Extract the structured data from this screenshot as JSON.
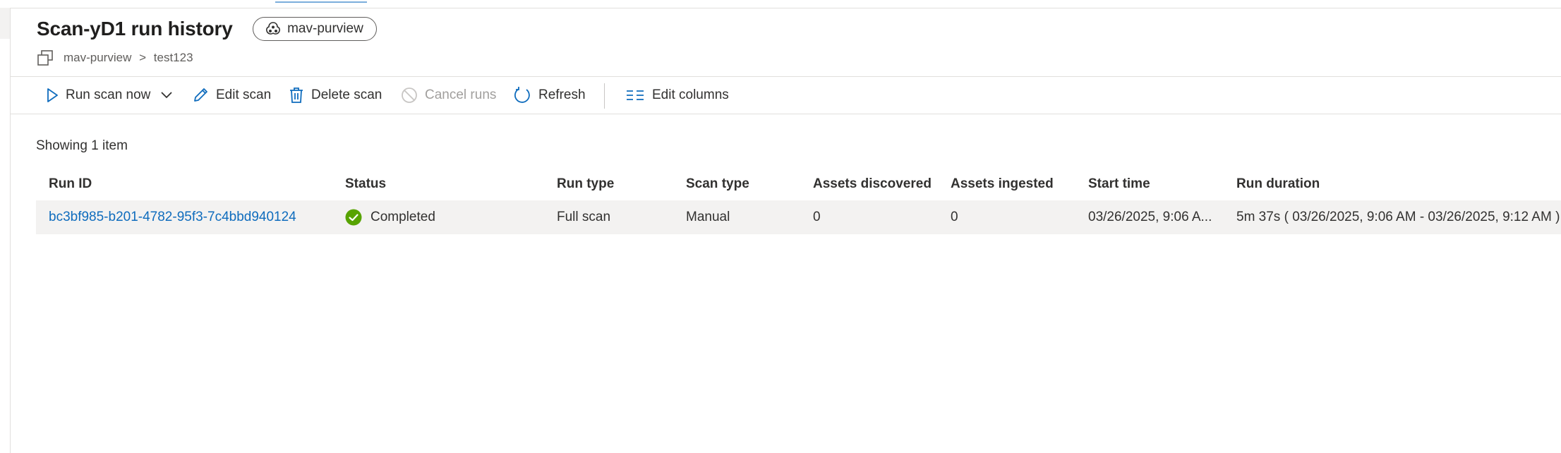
{
  "page": {
    "title": "Scan-yD1 run history",
    "data_source_pill": "mav-purview"
  },
  "breadcrumb": {
    "parent": "mav-purview",
    "separator": ">",
    "current": "test123"
  },
  "toolbar": {
    "run_scan_now": "Run scan now",
    "edit_scan": "Edit scan",
    "delete_scan": "Delete scan",
    "cancel_runs": "Cancel runs",
    "refresh": "Refresh",
    "edit_columns": "Edit columns"
  },
  "list": {
    "showing_text": "Showing 1 item",
    "columns": {
      "run_id": "Run ID",
      "status": "Status",
      "run_type": "Run type",
      "scan_type": "Scan type",
      "assets_discovered": "Assets discovered",
      "assets_ingested": "Assets ingested",
      "start_time": "Start time",
      "run_duration": "Run duration"
    },
    "rows": [
      {
        "run_id": "bc3bf985-b201-4782-95f3-7c4bbd940124",
        "status": "Completed",
        "run_type": "Full scan",
        "scan_type": "Manual",
        "assets_discovered": "0",
        "assets_ingested": "0",
        "start_time": "03/26/2025, 9:06 A...",
        "run_duration": "5m 37s ( 03/26/2025, 9:06 AM - 03/26/2025, 9:12 AM )"
      }
    ]
  },
  "colors": {
    "accent": "#0f6cbd",
    "success": "#57a300",
    "row_background": "#f3f2f1",
    "disabled_text": "#a19f9d"
  },
  "icons": {
    "pill": "purview-logo-icon",
    "breadcrumb": "collection-icon",
    "run": "play-icon",
    "dropdown": "chevron-down-icon",
    "edit": "pencil-icon",
    "delete": "trash-icon",
    "cancel": "cancel-icon",
    "refresh": "refresh-icon",
    "columns": "columns-icon",
    "status": "checkmark-circle-icon"
  }
}
